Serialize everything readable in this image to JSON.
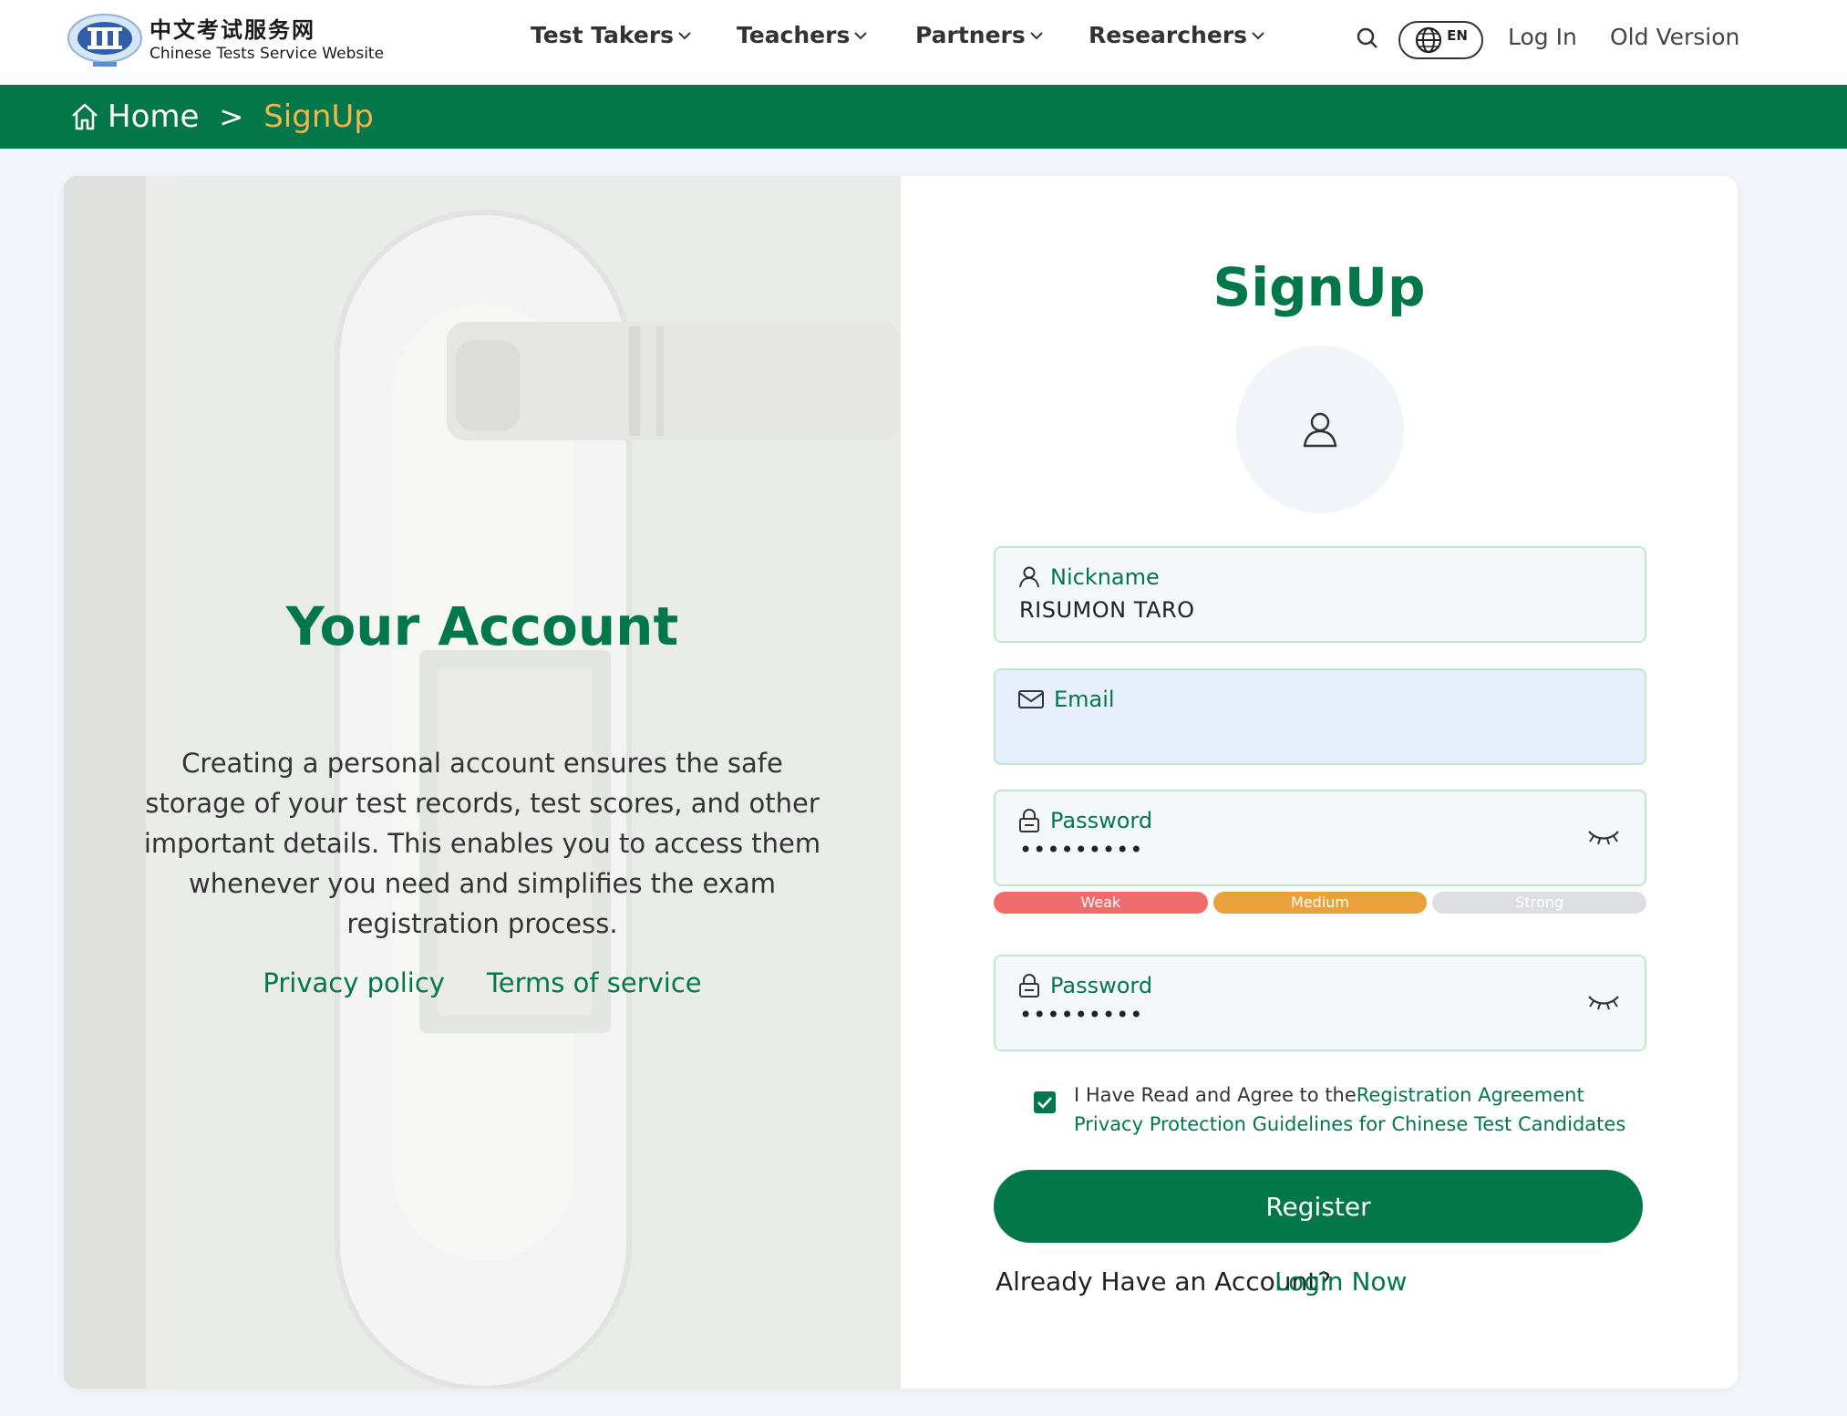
{
  "header": {
    "logo_cn": "中文考试服务网",
    "logo_en": "Chinese Tests Service Website",
    "nav": [
      {
        "label": "Test Takers"
      },
      {
        "label": "Teachers"
      },
      {
        "label": "Partners"
      },
      {
        "label": "Researchers"
      }
    ],
    "lang_label": "EN",
    "login_label": "Log In",
    "old_version_label": "Old Version"
  },
  "breadcrumb": {
    "home": "Home",
    "separator": ">",
    "current": "SignUp"
  },
  "left": {
    "title": "Your Account",
    "description": "Creating a personal account ensures the safe storage of your test records, test scores, and other important details. This enables you to access them whenever you need and simplifies the exam registration process.",
    "privacy_label": "Privacy policy",
    "terms_label": "Terms of service"
  },
  "form": {
    "title": "SignUp",
    "nickname": {
      "label": "Nickname",
      "value": "RISUMON TARO"
    },
    "email": {
      "label": "Email",
      "value": ""
    },
    "password": {
      "label": "Password",
      "masked": "•••••••••"
    },
    "password_confirm": {
      "label": "Password",
      "masked": "•••••••••"
    },
    "strength": [
      {
        "label": "Weak",
        "color": "#f06b6b"
      },
      {
        "label": "Medium",
        "color": "#e9a23b"
      },
      {
        "label": "Strong",
        "color": "#dcdee3"
      }
    ],
    "agree_prefix": "I Have Read and Agree to the",
    "agree_link": "Registration Agreement Privacy Protection Guidelines for Chinese Test Candidates",
    "agree_checked": true,
    "register_label": "Register",
    "already_text": "Already Have an Account?",
    "login_now_label": "Login Now"
  },
  "colors": {
    "brand_green": "#02774a",
    "breadcrumb_current": "#f1b64b",
    "field_border": "#bfe7cd"
  },
  "icons": [
    "search-icon",
    "globe-icon",
    "chevron-down-icon",
    "home-icon",
    "user-icon",
    "mail-icon",
    "lock-icon",
    "eye-closed-icon",
    "check-icon"
  ]
}
